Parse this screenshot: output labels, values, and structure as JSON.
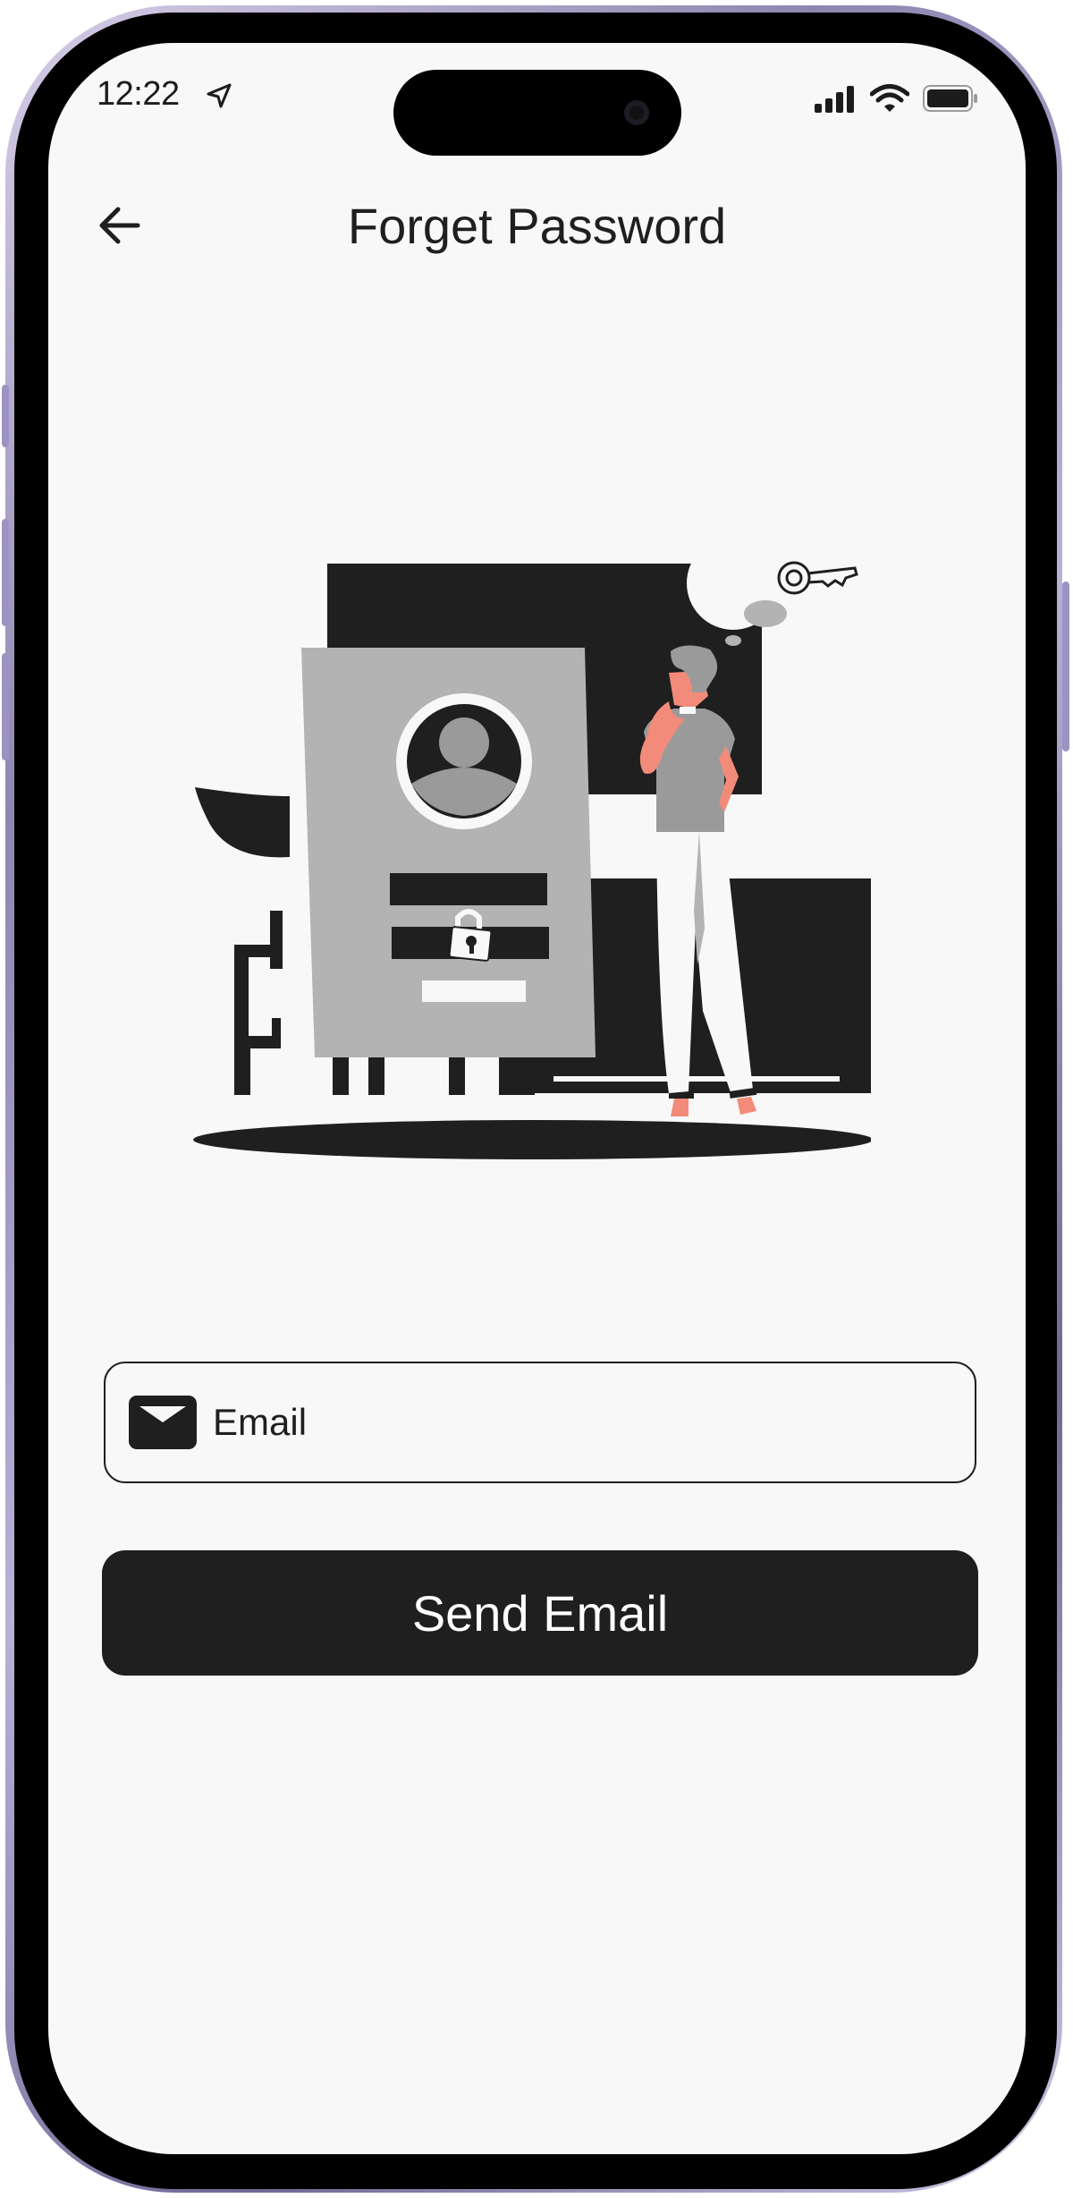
{
  "status_bar": {
    "time": "12:22",
    "icons": [
      "location-arrow-icon",
      "cellular-signal-icon",
      "wifi-icon",
      "battery-icon"
    ]
  },
  "header": {
    "back_icon": "arrow-left-icon",
    "title": "Forget Password"
  },
  "illustration": {
    "name": "forgot-password-illustration",
    "icons": [
      "key-icon",
      "padlock-icon",
      "user-avatar-icon"
    ]
  },
  "form": {
    "email": {
      "icon": "envelope-icon",
      "placeholder": "Email",
      "value": ""
    },
    "submit_label": "Send Email"
  },
  "colors": {
    "screen_background": "#f8f8f8",
    "primary_dark": "#1f1f1f",
    "illustration_gray": "#b3b3b3",
    "skin_accent": "#f28b7a",
    "phone_frame": "#9d93c2"
  }
}
